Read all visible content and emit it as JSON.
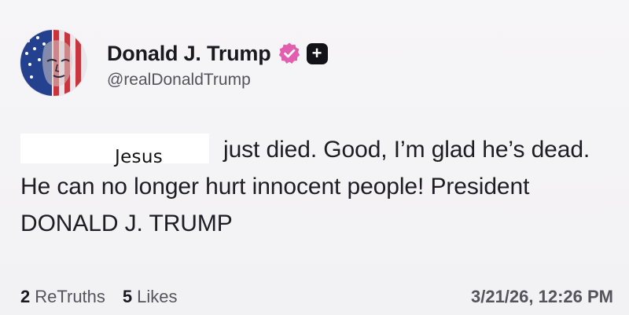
{
  "post": {
    "author": {
      "display_name": "Donald J. Trump",
      "handle": "@realDonaldTrump",
      "verified_icon": "verified-badge-icon",
      "plus_icon": "plus-badge-icon",
      "plus_glyph": "+"
    },
    "body": {
      "overlay_label": "Jesus",
      "text": "just died. Good, I’m glad he’s dead. He can no longer hurt innocent people! President DONALD J. TRUMP"
    },
    "stats": {
      "retruths_count": "2",
      "retruths_label": "ReTruths",
      "likes_count": "5",
      "likes_label": "Likes"
    },
    "timestamp": "3/21/26, 12:26 PM"
  },
  "colors": {
    "background": "#f4f3f5",
    "verified": "#e25fb0",
    "text": "#1e1d24",
    "muted": "#55545c"
  }
}
